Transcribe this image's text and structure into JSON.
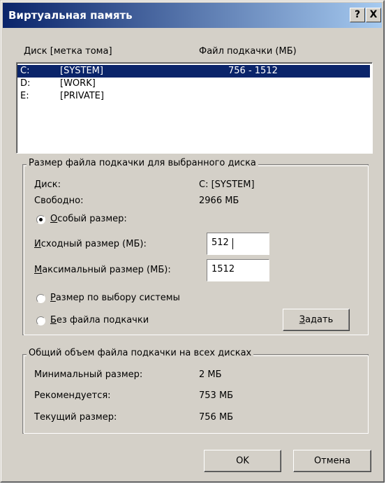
{
  "title": "Виртуальная память",
  "title_buttons": {
    "help": "?",
    "close": "X"
  },
  "list": {
    "header_drive_prefix": "Диск ",
    "header_drive_accel": "[",
    "header_drive_rest": "метка тома]",
    "header_file": "Файл подкачки (МБ)",
    "rows": [
      {
        "drive": "C:",
        "label": "[SYSTEM]",
        "size": "756 - 1512",
        "selected": true
      },
      {
        "drive": "D:",
        "label": "[WORK]",
        "size": "",
        "selected": false
      },
      {
        "drive": "E:",
        "label": "[PRIVATE]",
        "size": "",
        "selected": false
      }
    ]
  },
  "selected_group": {
    "legend": "Размер файла подкачки для выбранного диска",
    "disk_label": "Диск:",
    "disk_value": "C:  [SYSTEM]",
    "free_label": "Свободно:",
    "free_value": "2966 МБ",
    "custom_accel": "О",
    "custom_rest": "собый размер:",
    "initial_accel": "И",
    "initial_rest": "сходный размер (МБ):",
    "initial_value": "512",
    "max_accel": "М",
    "max_rest": "аксимальный размер (МБ):",
    "max_value": "1512",
    "system_accel": "Р",
    "system_rest": "азмер по выбору системы",
    "nofile_accel": "Б",
    "nofile_rest": "ез файла подкачки",
    "set_accel": "З",
    "set_rest": "адать",
    "selected_option": "custom"
  },
  "total_group": {
    "legend": "Общий объем файла подкачки на всех дисках",
    "min_label": "Минимальный размер:",
    "min_value": "2 МБ",
    "recommended_label": "Рекомендуется:",
    "recommended_value": "753 МБ",
    "current_label": "Текущий размер:",
    "current_value": "756 МБ"
  },
  "buttons": {
    "ok": "OK",
    "cancel": "Отмена"
  },
  "colors": {
    "titlebar_start": "#0a246a",
    "titlebar_end": "#a6caf0",
    "face": "#d4d0c8",
    "selection": "#0a246a"
  }
}
